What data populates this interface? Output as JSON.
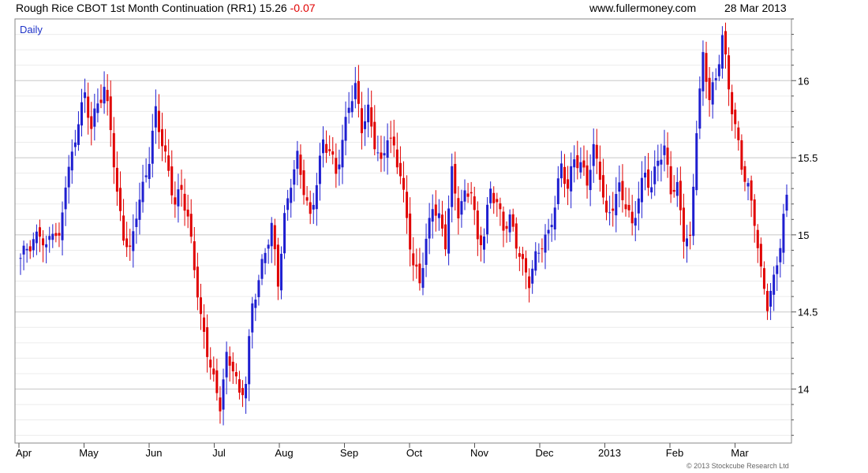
{
  "header": {
    "title": "Rough Rice CBOT 1st Month Continuation (RR1)",
    "last": "15.26",
    "change": "-0.07",
    "website": "www.fullermoney.com",
    "date": "28 Mar 2013"
  },
  "period_label": "Daily",
  "copyright": "© 2013 Stockcube Research Ltd",
  "colors": {
    "up": "#1f1fd0",
    "down": "#e00000",
    "grid": "#d4d4d4",
    "frame": "#888888"
  },
  "chart_data": {
    "type": "candlestick",
    "title": "Rough Rice CBOT 1st Month Continuation (RR1)",
    "ylim": [
      13.65,
      16.4
    ],
    "yticks": [
      14,
      14.5,
      15,
      15.5,
      16
    ],
    "x_labels": [
      "Apr",
      "May",
      "Jun",
      "Jul",
      "Aug",
      "Sep",
      "Oct",
      "Nov",
      "Dec",
      "2013",
      "Feb",
      "Mar"
    ],
    "grid": true,
    "last_close": 15.26,
    "close_series": [
      14.85,
      14.92,
      14.95,
      15.02,
      14.9,
      15.05,
      14.95,
      15.35,
      15.5,
      15.75,
      15.9,
      15.7,
      15.85,
      15.95,
      15.7,
      15.25,
      15.0,
      14.88,
      15.15,
      15.3,
      15.5,
      15.8,
      15.6,
      15.4,
      15.2,
      15.3,
      15.1,
      14.8,
      14.45,
      14.25,
      14.05,
      13.9,
      14.2,
      14.15,
      13.95,
      14.05,
      14.55,
      14.7,
      14.9,
      15.05,
      14.7,
      15.1,
      15.35,
      15.5,
      15.3,
      15.1,
      15.35,
      15.6,
      15.55,
      15.4,
      15.6,
      15.85,
      15.95,
      15.7,
      15.8,
      15.6,
      15.45,
      15.65,
      15.55,
      15.4,
      15.1,
      14.8,
      14.7,
      14.95,
      15.2,
      15.1,
      14.95,
      15.4,
      15.15,
      15.25,
      15.3,
      14.95,
      15.0,
      15.3,
      15.2,
      15.05,
      15.1,
      14.95,
      14.8,
      14.7,
      14.85,
      14.95,
      15.0,
      15.2,
      15.45,
      15.3,
      15.5,
      15.45,
      15.35,
      15.55,
      15.4,
      15.1,
      15.2,
      15.3,
      15.2,
      15.05,
      15.25,
      15.4,
      15.3,
      15.5,
      15.55,
      15.3,
      15.3,
      15.0,
      14.95,
      15.7,
      16.15,
      15.9,
      16.0,
      16.3,
      15.95,
      15.7,
      15.45,
      15.3,
      15.1,
      14.75,
      14.55,
      14.7,
      14.95,
      15.26
    ]
  }
}
